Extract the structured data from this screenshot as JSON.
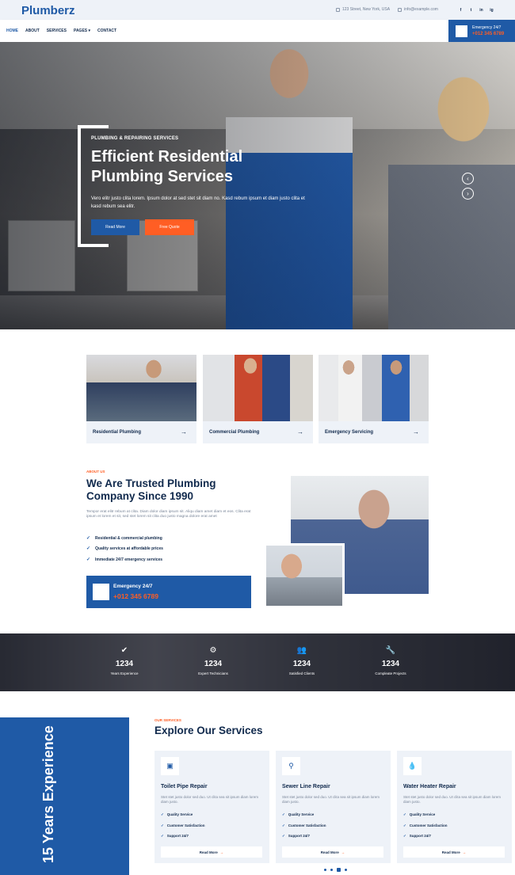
{
  "brand": {
    "logo": "Plumberz",
    "accent": "#1f5aa6",
    "orange": "#ff5e24"
  },
  "topbar": {
    "address": "123 Street, New York, USA",
    "email": "info@example.com",
    "socials": [
      "f",
      "t",
      "in",
      "ig"
    ]
  },
  "nav": {
    "items": [
      "HOME",
      "ABOUT",
      "SERVICES",
      "PAGES ▾",
      "CONTACT"
    ]
  },
  "emergency_top": {
    "label": "Emergency 24/7",
    "phone": "+012 345 6789"
  },
  "hero": {
    "subtitle": "PLUMBING & REPAIRING SERVICES",
    "title": "Efficient Residential Plumbing Services",
    "description": "Vero elitr justo clita lorem. Ipsum dolor at sed stet sit diam no. Kasd rebum ipsum et diam justo clita et kasd rebum sea elitr.",
    "read_more": "Read More",
    "free_quote": "Free Quote",
    "prev_icon": "chevron-left-icon",
    "next_icon": "chevron-right-icon"
  },
  "feature_cards": [
    {
      "label": "Residential Plumbing"
    },
    {
      "label": "Commercial Plumbing"
    },
    {
      "label": "Emergency Servicing"
    }
  ],
  "about": {
    "tag": "ABOUT US",
    "title": "We Are Trusted Plumbing Company Since 1990",
    "text": "Tempor erat elitr rebum at clita. Diam dolor diam ipsum sit. Aliqu diam amet diam et eos. Clita erat ipsum et lorem et sit, sed stet lorem sit clita duo justo magna dolore erat amet",
    "checks": [
      "Residential & commercial plumbing",
      "Quality services at affordable prices",
      "Immediate 24/7 emergency services"
    ],
    "emergency_label": "Emergency 24/7",
    "emergency_phone": "+012 345 6789"
  },
  "stats": [
    {
      "icon": "check-icon",
      "value": "1234",
      "label": "Years Experience"
    },
    {
      "icon": "users-cog-icon",
      "value": "1234",
      "label": "Expert Technicians"
    },
    {
      "icon": "users-icon",
      "value": "1234",
      "label": "Satisfied Clients"
    },
    {
      "icon": "wrench-icon",
      "value": "1234",
      "label": "Compleate Projects"
    }
  ],
  "services": {
    "experience": "15 Years Experience",
    "tag": "OUR SERVICES",
    "title": "Explore Our Services",
    "cards": [
      {
        "title": "Toilet Pipe Repair",
        "desc": "Stet stet justo dolor sed duo. Ut clita sea sit ipsum diam lorem diam justo.",
        "features": [
          "Quality Service",
          "Customer Satisfaction",
          "Support 24/7"
        ],
        "read_more": "Read More"
      },
      {
        "title": "Sewer Line Repair",
        "desc": "Stet stet justo dolor sed duo. Ut clita sea sit ipsum diam lorem diam justo.",
        "features": [
          "Quality Service",
          "Customer Satisfaction",
          "Support 24/7"
        ],
        "read_more": "Read More"
      },
      {
        "title": "Water Heater Repair",
        "desc": "Stet stet justo dolor sed duo. Ut clita sea sit ipsum diam lorem diam justo.",
        "features": [
          "Quality Service",
          "Customer Satisfaction",
          "Support 24/7"
        ],
        "read_more": "Read More"
      }
    ]
  }
}
